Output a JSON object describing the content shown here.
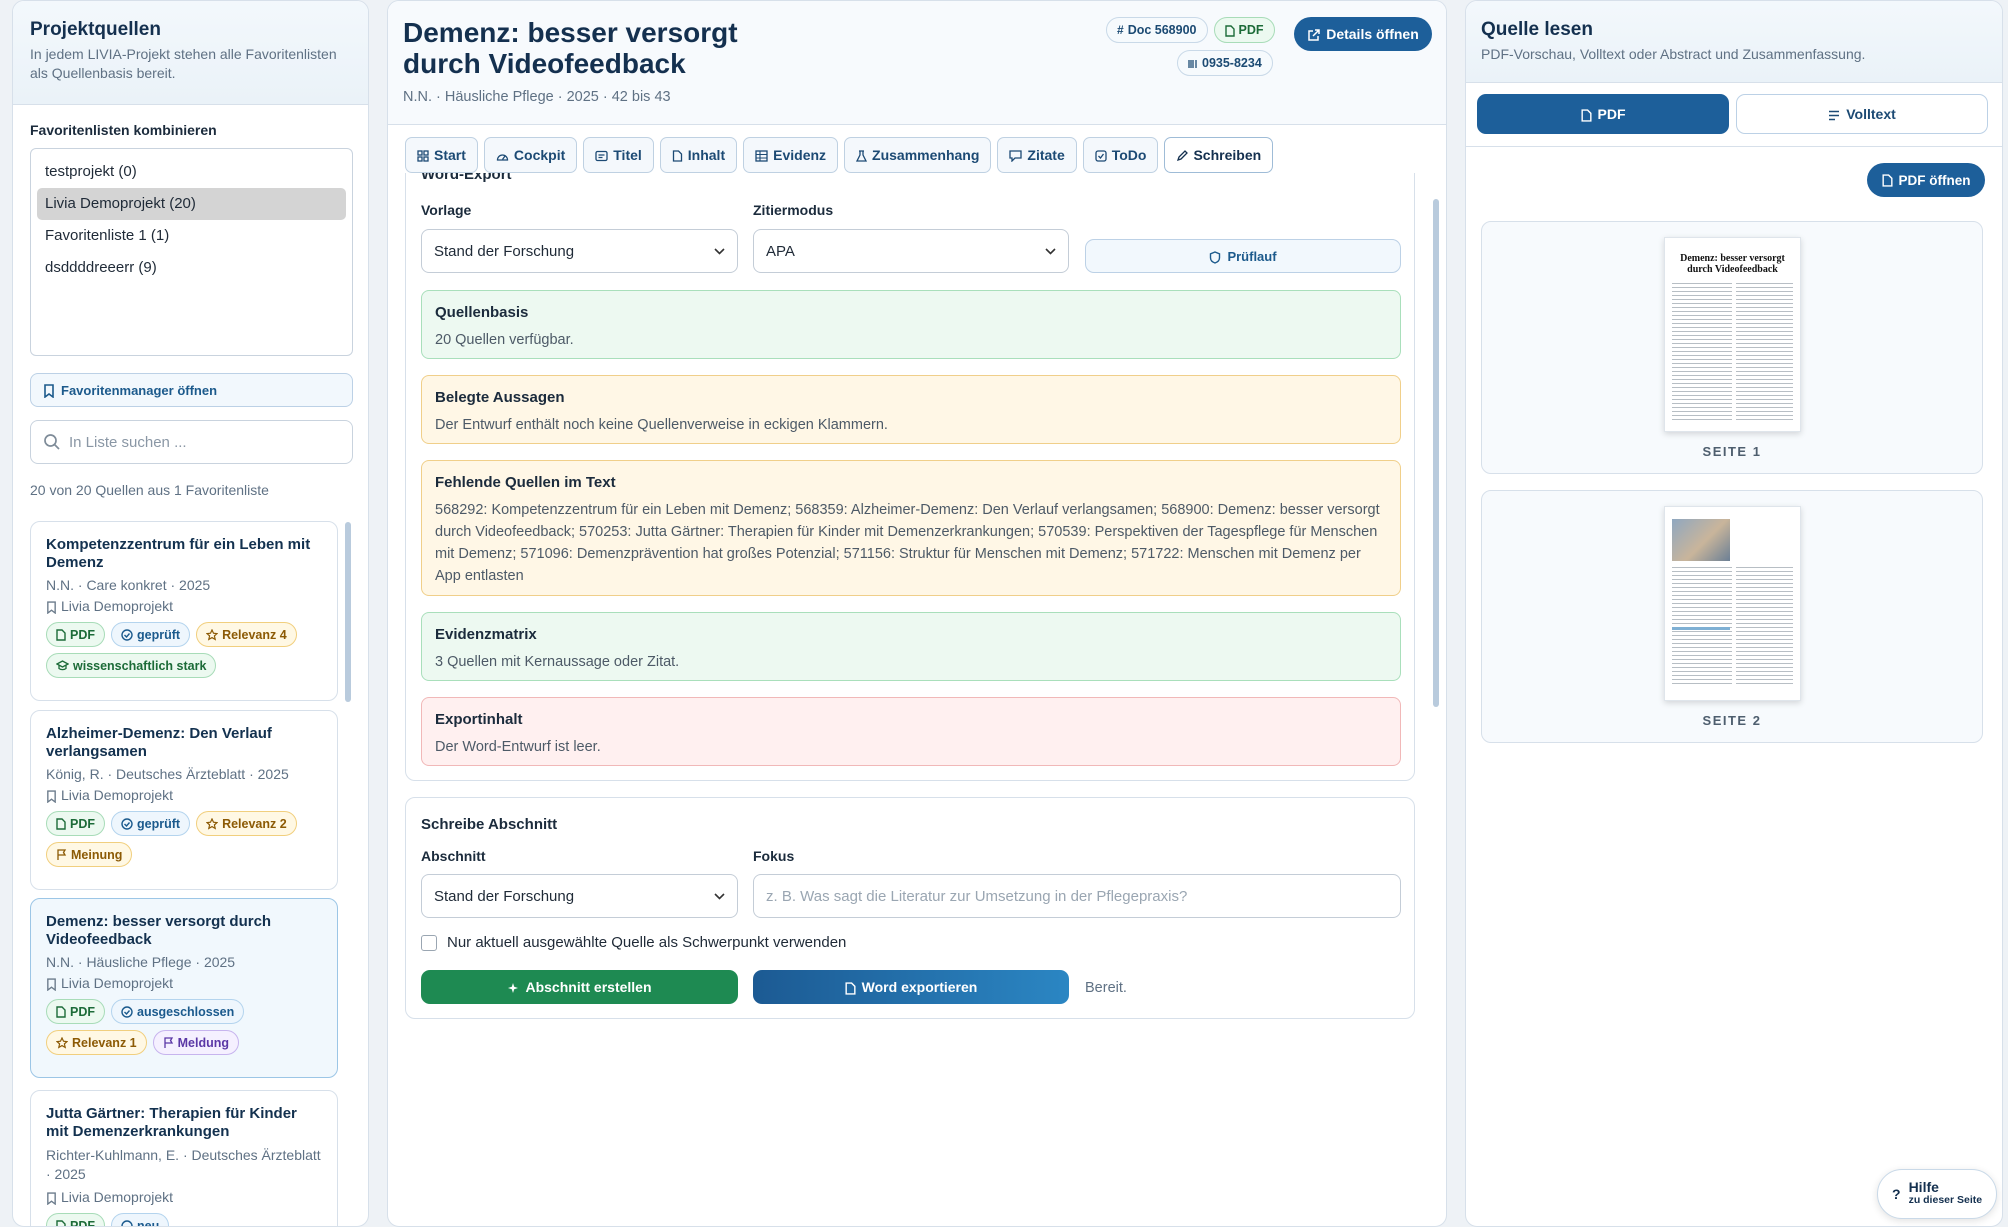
{
  "left": {
    "title": "Projektquellen",
    "subtitle": "In jedem LIVIA-Projekt stehen alle Favoritenlisten als Quellenbasis bereit.",
    "combine_label": "Favoritenlisten kombinieren",
    "lists": [
      "testprojekt (0)",
      "Livia Demoprojekt (20)",
      "Favoritenliste 1 (1)",
      "dsddddreeerr (9)"
    ],
    "manager_button": "Favoritenmanager öffnen",
    "search_placeholder": "In Liste suchen ...",
    "count_text": "20 von 20 Quellen aus 1 Favoritenliste",
    "cards": [
      {
        "title": "Kompetenzzentrum für ein Leben mit Demenz",
        "meta": "N.N. · Care konkret · 2025",
        "project": "Livia Demoprojekt",
        "tags": [
          {
            "label": "PDF",
            "icon": "doc-icon"
          },
          {
            "label": "geprüft",
            "icon": "check-circle-icon"
          },
          {
            "label": "Relevanz 4",
            "icon": "star-icon"
          },
          {
            "label": "wissenschaftlich stark",
            "icon": "cap-icon"
          }
        ]
      },
      {
        "title": "Alzheimer-Demenz: Den Verlauf verlangsamen",
        "meta": "König, R. · Deutsches Ärzteblatt · 2025",
        "project": "Livia Demoprojekt",
        "tags": [
          {
            "label": "PDF",
            "icon": "doc-icon"
          },
          {
            "label": "geprüft",
            "icon": "check-circle-icon"
          },
          {
            "label": "Relevanz 2",
            "icon": "star-icon"
          },
          {
            "label": "Meinung",
            "icon": "flag-icon"
          }
        ]
      },
      {
        "title": "Demenz: besser versorgt durch Videofeedback",
        "meta": "N.N. · Häusliche Pflege · 2025",
        "project": "Livia Demoprojekt",
        "tags": [
          {
            "label": "PDF",
            "icon": "doc-icon"
          },
          {
            "label": "ausgeschlossen",
            "icon": "check-circle-icon"
          },
          {
            "label": "Relevanz 1",
            "icon": "star-icon"
          },
          {
            "label": "Meldung",
            "icon": "flag-icon"
          }
        ]
      },
      {
        "title": "Jutta Gärtner: Therapien für Kinder mit Demenzerkrankungen",
        "meta": "Richter-Kuhlmann, E. · Deutsches Ärzteblatt · 2025",
        "project": "Livia Demoprojekt",
        "tags": [
          {
            "label": "PDF",
            "icon": "doc-icon"
          },
          {
            "label": "neu",
            "icon": "circle-icon"
          }
        ]
      }
    ]
  },
  "header": {
    "title_line1": "Demenz: besser versorgt",
    "title_line2": "durch Videofeedback",
    "meta": "N.N. · Häusliche Pflege · 2025 · 42 bis 43",
    "doc_chip": "Doc 568900",
    "pdf_chip": "PDF",
    "issn_chip": "0935-8234",
    "details_button": "Details öffnen"
  },
  "tabs": [
    "Start",
    "Cockpit",
    "Titel",
    "Inhalt",
    "Evidenz",
    "Zusammenhang",
    "Zitate",
    "ToDo",
    "Schreiben"
  ],
  "export": {
    "section_title": "Word-Export",
    "vorlage_label": "Vorlage",
    "vorlage_value": "Stand der Forschung",
    "zitiermodus_label": "Zitiermodus",
    "zitiermodus_value": "APA",
    "pruef_button": "Prüflauf",
    "boxes": [
      {
        "title": "Quellenbasis",
        "text": "20 Quellen verfügbar.",
        "status": "green"
      },
      {
        "title": "Belegte Aussagen",
        "text": "Der Entwurf enthält noch keine Quellenverweise in eckigen Klammern.",
        "status": "yellow"
      },
      {
        "title": "Fehlende Quellen im Text",
        "text": "568292: Kompetenzzentrum für ein Leben mit Demenz; 568359: Alzheimer-Demenz: Den Verlauf verlangsamen; 568900: Demenz: besser versorgt durch Videofeedback; 570253: Jutta Gärtner: Therapien für Kinder mit Demenzerkrankungen; 570539: Perspektiven der Tagespflege für Menschen mit Demenz; 571096: Demenzprävention hat großes Potenzial; 571156: Struktur für Menschen mit Demenz; 571722: Menschen mit Demenz per App entlasten",
        "status": "yellow"
      },
      {
        "title": "Evidenzmatrix",
        "text": "3 Quellen mit Kernaussage oder Zitat.",
        "status": "green"
      },
      {
        "title": "Exportinhalt",
        "text": "Der Word-Entwurf ist leer.",
        "status": "red"
      }
    ]
  },
  "write": {
    "section_title": "Schreibe Abschnitt",
    "abschnitt_label": "Abschnitt",
    "abschnitt_value": "Stand der Forschung",
    "fokus_label": "Fokus",
    "fokus_placeholder": "z. B. Was sagt die Literatur zur Umsetzung in der Pflegepraxis?",
    "checkbox_label": "Nur aktuell ausgewählte Quelle als Schwerpunkt verwenden",
    "create_button": "Abschnitt erstellen",
    "export_button": "Word exportieren",
    "status": "Bereit."
  },
  "right": {
    "title": "Quelle lesen",
    "subtitle": "PDF-Vorschau, Volltext oder Abstract und Zusammenfassung.",
    "tab_pdf": "PDF",
    "tab_volltext": "Volltext",
    "open_pdf": "PDF öffnen",
    "page1_label": "SEITE 1",
    "page2_label": "SEITE 2",
    "thumb_title_line1": "Demenz: besser versorgt",
    "thumb_title_line2": "durch Videofeedback",
    "help_main": "Hilfe",
    "help_sub": "zu dieser Seite"
  },
  "colors": {
    "accent": "#1d5f9a",
    "green_button": "#1e8a52",
    "brand_dark": "#14304f"
  }
}
